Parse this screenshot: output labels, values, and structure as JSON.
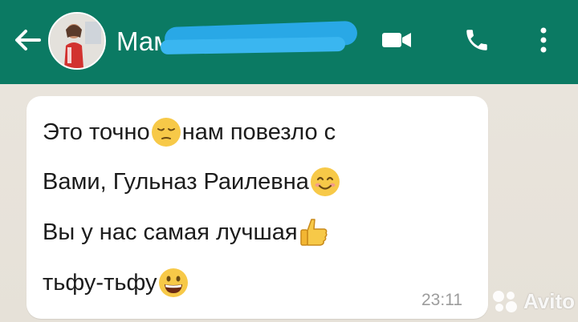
{
  "header": {
    "contact_name": "Мама",
    "icons": {
      "back": "arrow-left-icon",
      "video": "video-camera-icon",
      "call": "phone-icon",
      "menu": "more-vert-icon"
    },
    "colors": {
      "bar": "#0b7a63",
      "redaction": "#29a8e6"
    }
  },
  "message": {
    "lines": [
      {
        "before": "Это точно",
        "emoji": "pensive-face",
        "after": " нам повезло с"
      },
      {
        "before": "Вами, Гульназ Раилевна",
        "emoji": "smiling-face",
        "after": ""
      },
      {
        "before": "Вы у нас самая лучшая",
        "emoji": "thumbs-up",
        "after": ""
      },
      {
        "before": "тьфу-тьфу",
        "emoji": "grinning-face",
        "after": ""
      }
    ],
    "time": "23:11"
  },
  "watermark": {
    "text": "Avito"
  }
}
